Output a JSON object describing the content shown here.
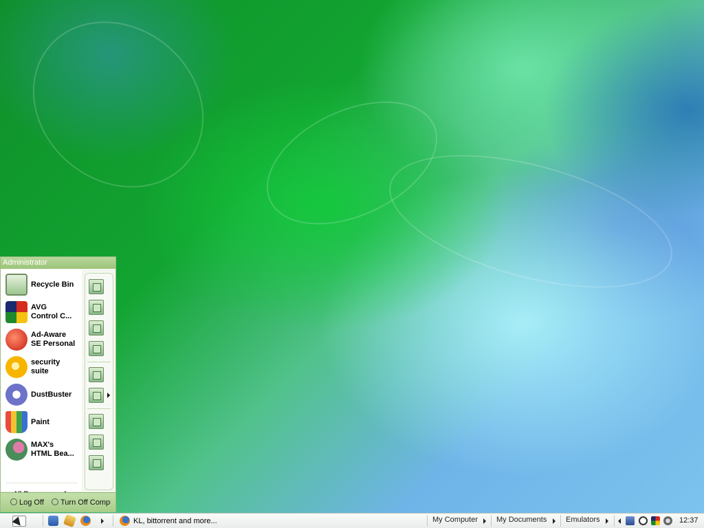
{
  "start_menu": {
    "user": "Administrator",
    "programs": [
      {
        "label": "Recycle Bin",
        "icon": "recycle-bin-icon"
      },
      {
        "label": "AVG\nControl C...",
        "icon": "avg-icon"
      },
      {
        "label": "Ad-Aware\nSE Personal",
        "icon": "ad-aware-icon"
      },
      {
        "label": "security\nsuite",
        "icon": "security-suite-icon"
      },
      {
        "label": "DustBuster",
        "icon": "dustbuster-icon"
      },
      {
        "label": "Paint",
        "icon": "paint-icon"
      },
      {
        "label": "MAX's\nHTML Bea...",
        "icon": "html-beauty-icon"
      }
    ],
    "all_programs": "All Programs",
    "log_off": "Log Off",
    "turn_off": "Turn Off Computer"
  },
  "taskbar": {
    "task": "KL, bittorrent and more...",
    "toolbars": [
      "My Computer",
      "My Documents",
      "Emulators"
    ],
    "clock": "12:37"
  },
  "colors": {
    "menu_header": "#9cc479",
    "menu_footer": "#a7cd89"
  }
}
